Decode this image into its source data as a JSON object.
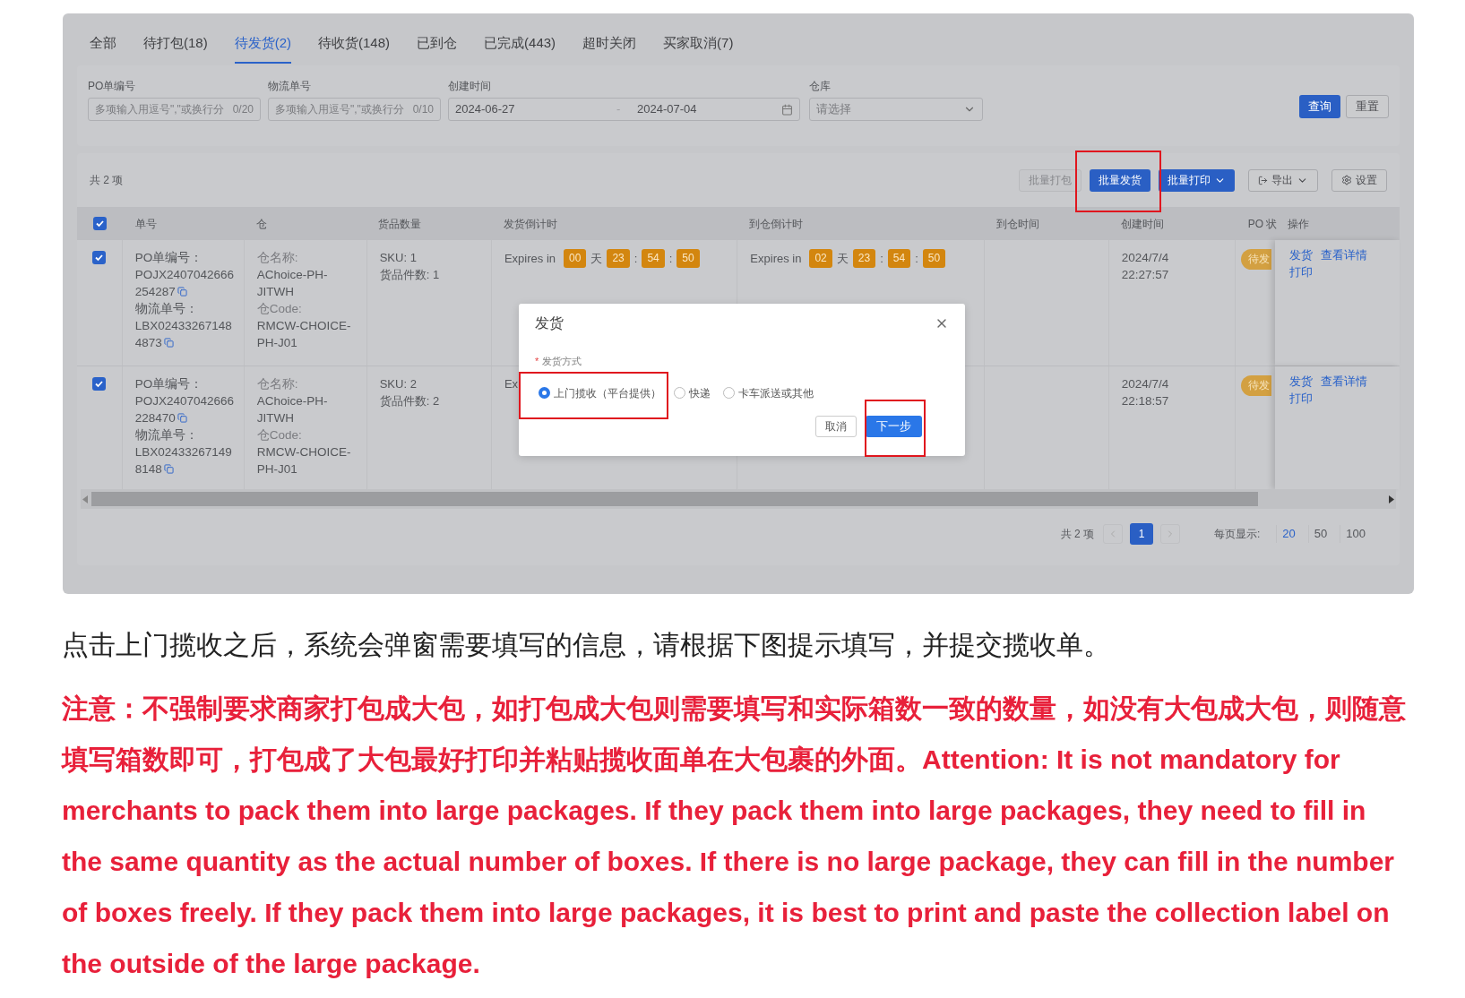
{
  "tabs": [
    {
      "label": "全部",
      "selected": false
    },
    {
      "label": "待打包(18)",
      "selected": false
    },
    {
      "label": "待发货(2)",
      "selected": true
    },
    {
      "label": "待收货(148)",
      "selected": false
    },
    {
      "label": "已到仓",
      "selected": false
    },
    {
      "label": "已完成(443)",
      "selected": false
    },
    {
      "label": "超时关闭",
      "selected": false
    },
    {
      "label": "买家取消(7)",
      "selected": false
    }
  ],
  "filters": {
    "po": {
      "label": "PO单编号",
      "placeholder": "多项输入用逗号\",\"或换行分",
      "counter": "0/20"
    },
    "logistics": {
      "label": "物流单号",
      "placeholder": "多项输入用逗号\",\"或换行分",
      "counter": "0/10"
    },
    "created": {
      "label": "创建时间",
      "start": "2024-06-27",
      "separator": "-",
      "end": "2024-07-04"
    },
    "warehouse": {
      "label": "仓库",
      "placeholder": "请选择"
    },
    "buttons": [
      {
        "label": "查询",
        "kind": "primary"
      },
      {
        "label": "重置",
        "kind": "outline"
      }
    ]
  },
  "toolbar": {
    "total": "共 2 项",
    "buttons": [
      {
        "label": "批量打包",
        "kind": "plain",
        "disabled": true
      },
      {
        "label": "批量发货",
        "kind": "primary",
        "disabled": false
      },
      {
        "label": "批量打印",
        "kind": "primary-dropdown",
        "disabled": false
      },
      {
        "label": "导出",
        "kind": "export",
        "disabled": false
      },
      {
        "label": "设置",
        "kind": "settings",
        "disabled": false
      }
    ]
  },
  "table": {
    "all_checked": true,
    "columns": [
      "单号",
      "仓",
      "货品数量",
      "发货倒计时",
      "到仓倒计时",
      "到仓时间",
      "创建时间",
      "PO 状",
      "操作"
    ],
    "rows": [
      {
        "checked": true,
        "po_label": "PO单编号：",
        "po_number": [
          "POJX2407042666",
          "254287"
        ],
        "logistics_label": "物流单号：",
        "logistics_number": [
          "LBX02433267148",
          "4873"
        ],
        "wh_name_label": "仓名称:",
        "wh_name": "AChoice-PH-JITWH",
        "wh_code_label": "仓Code:",
        "wh_code": "RMCW-CHOICE-PH-J01",
        "sku": "SKU: 1",
        "pieces": "货品件数: 1",
        "ship_countdown": {
          "prefix": "Expires in",
          "parts": [
            {
              "kind": "chip",
              "text": "00"
            },
            {
              "kind": "unit",
              "text": "天"
            },
            {
              "kind": "chip",
              "text": "23"
            },
            {
              "kind": "sep",
              "text": ":"
            },
            {
              "kind": "chip",
              "text": "54"
            },
            {
              "kind": "sep",
              "text": ":"
            },
            {
              "kind": "chip",
              "text": "50"
            }
          ]
        },
        "arrive_countdown": {
          "prefix": "Expires in",
          "parts": [
            {
              "kind": "chip",
              "text": "02"
            },
            {
              "kind": "unit",
              "text": "天"
            },
            {
              "kind": "chip",
              "text": "23"
            },
            {
              "kind": "sep",
              "text": ":"
            },
            {
              "kind": "chip",
              "text": "54"
            },
            {
              "kind": "sep",
              "text": ":"
            },
            {
              "kind": "chip",
              "text": "50"
            }
          ]
        },
        "created_date": "2024/7/4",
        "created_time": "22:27:57",
        "status": "待发",
        "actions": [
          "发货",
          "查看详情",
          "打印"
        ]
      },
      {
        "checked": true,
        "po_label": "PO单编号：",
        "po_number": [
          "POJX2407042666",
          "228470"
        ],
        "logistics_label": "物流单号：",
        "logistics_number": [
          "LBX02433267149",
          "8148"
        ],
        "wh_name_label": "仓名称:",
        "wh_name": "AChoice-PH-JITWH",
        "wh_code_label": "仓Code:",
        "wh_code": "RMCW-CHOICE-PH-J01",
        "sku": "SKU: 2",
        "pieces": "货品件数: 2",
        "ship_countdown": {
          "prefix": "Ex"
        },
        "created_date": "2024/7/4",
        "created_time": "22:18:57",
        "status": "待发",
        "actions": [
          "发货",
          "查看详情",
          "打印"
        ]
      }
    ]
  },
  "pagination": {
    "total": "共 2 项",
    "pages": [
      {
        "label": "1",
        "selected": true
      }
    ],
    "size_label": "每页显示:",
    "sizes": [
      {
        "label": "20",
        "selected": true
      },
      {
        "label": "50",
        "selected": false
      },
      {
        "label": "100",
        "selected": false
      }
    ]
  },
  "modal": {
    "title": "发货",
    "required_mark": "*",
    "field_label": "发货方式",
    "options": [
      {
        "label": "上门揽收（平台提供）",
        "selected": true
      },
      {
        "label": "快递",
        "selected": false
      },
      {
        "label": "卡车派送或其他",
        "selected": false
      }
    ],
    "cancel": "取消",
    "next": "下一步"
  },
  "intro": "点击上门揽收之后，系统会弹窗需要填写的信息，请根据下图提示填写，并提交揽收单。",
  "note": "注意：不强制要求商家打包成大包，如打包成大包则需要填写和实际箱数一致的数量，如没有大包成大包，则随意填写箱数即可，打包成了大包最好打印并粘贴揽收面单在大包裹的外面。Attention: It is not mandatory for merchants to pack them into large packages. If they pack them into large packages, they need to fill in the same quantity as the actual number of boxes. If there is no large package, they can fill in the number of boxes freely. If they pack them into large packages, it is best to print and paste the collection label on the outside of the large package."
}
